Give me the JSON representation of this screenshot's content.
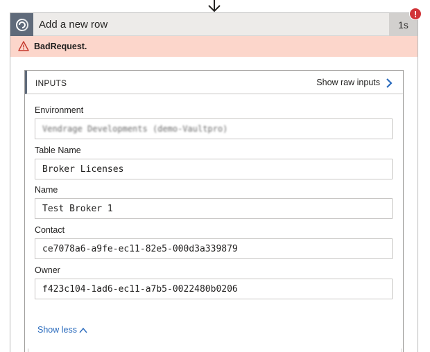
{
  "action": {
    "title": "Add a new row",
    "duration": "1s",
    "error_badge": "!",
    "error_message": "BadRequest."
  },
  "inputs": {
    "header": "INPUTS",
    "raw_link": "Show raw inputs",
    "fields": [
      {
        "label": "Environment",
        "value": "Vendrage Developments (demo-Vaultpro)"
      },
      {
        "label": "Table Name",
        "value": "Broker Licenses"
      },
      {
        "label": "Name",
        "value": "Test Broker 1"
      },
      {
        "label": "Contact",
        "value": "ce7078a6-a9fe-ec11-82e5-000d3a339879"
      },
      {
        "label": "Owner",
        "value": "f423c104-1ad6-ec11-a7b5-0022480b0206"
      }
    ],
    "show_less": "Show less"
  },
  "colors": {
    "header_bg": "#edebe9",
    "connector_icon_bg": "#5f6a7a",
    "error_banner_bg": "#fcd6cb",
    "error_badge": "#d13438",
    "warning_icon": "#c4372b",
    "link": "#2a6bbd"
  },
  "icons": {
    "connector": "dataverse-icon",
    "warning": "warning-triangle-icon",
    "raw_inputs": "chevron-right-icon",
    "collapse": "chevron-up-icon",
    "flow_arrow": "arrow-down-icon"
  }
}
